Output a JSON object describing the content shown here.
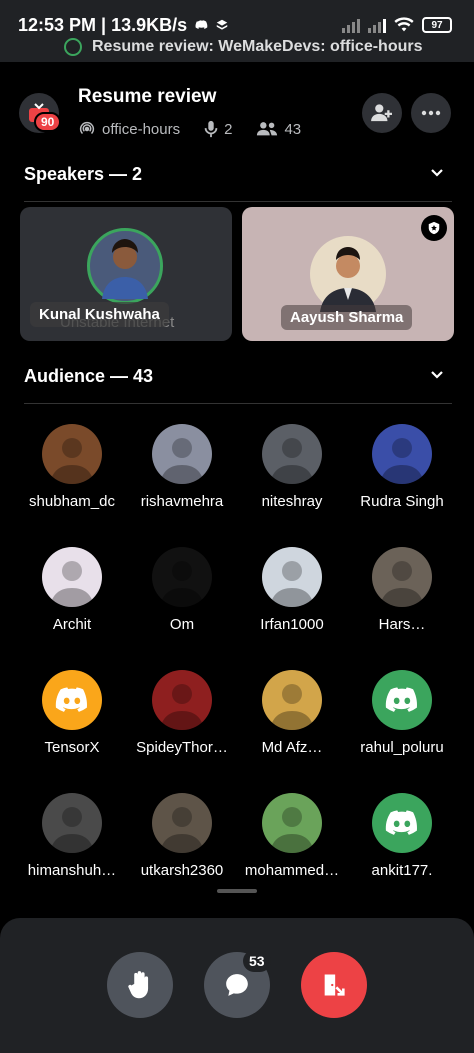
{
  "status_bar": {
    "time_speed": "12:53 PM | 13.9KB/s",
    "battery": "97",
    "now_playing": "Resume review: WeMakeDevs: office-hours"
  },
  "header": {
    "server_badge": "90",
    "title": "Resume review",
    "channel": "office-hours",
    "speaker_count": "2",
    "listener_count": "43"
  },
  "speakers": {
    "title": "Speakers — 2",
    "cards": [
      {
        "name": "Kunal Kushwaha",
        "status": "Unstable Internet",
        "bg": "#2f3136"
      },
      {
        "name": "Aayush Sharma",
        "status": "",
        "bg": "#c7b4b4"
      }
    ]
  },
  "audience": {
    "title": "Audience — 43",
    "members": [
      {
        "name": "shubham_dc",
        "color": "#7a4a2a",
        "icon": "photo"
      },
      {
        "name": "rishavmehra",
        "color": "#8a8fa0",
        "icon": "photo"
      },
      {
        "name": "niteshray",
        "color": "#5b5f66",
        "icon": "photo"
      },
      {
        "name": "Rudra Singh",
        "color": "#3a4ea8",
        "icon": "photo"
      },
      {
        "name": "Archit",
        "color": "#e8e0ea",
        "icon": "photo"
      },
      {
        "name": "Om",
        "color": "#111111",
        "icon": "photo"
      },
      {
        "name": "Irfan1000",
        "color": "#cfd6de",
        "icon": "photo"
      },
      {
        "name": "Hars…",
        "color": "#6b6258",
        "icon": "photo"
      },
      {
        "name": "TensorX",
        "color": "#faa61a",
        "icon": "discord"
      },
      {
        "name": "SpideyThor…",
        "color": "#8e1f1f",
        "icon": "photo"
      },
      {
        "name": "Md Afz…",
        "color": "#d2a54a",
        "icon": "photo"
      },
      {
        "name": "rahul_poluru",
        "color": "#3ba55d",
        "icon": "discord"
      },
      {
        "name": "himanshuh…",
        "color": "#4a4a4a",
        "icon": "photo"
      },
      {
        "name": "utkarsh2360",
        "color": "#5e5448",
        "icon": "photo"
      },
      {
        "name": "mohammed…",
        "color": "#6aa35a",
        "icon": "photo"
      },
      {
        "name": "ankit177.",
        "color": "#3ba55d",
        "icon": "discord"
      }
    ]
  },
  "bottom_bar": {
    "chat_count": "53"
  }
}
